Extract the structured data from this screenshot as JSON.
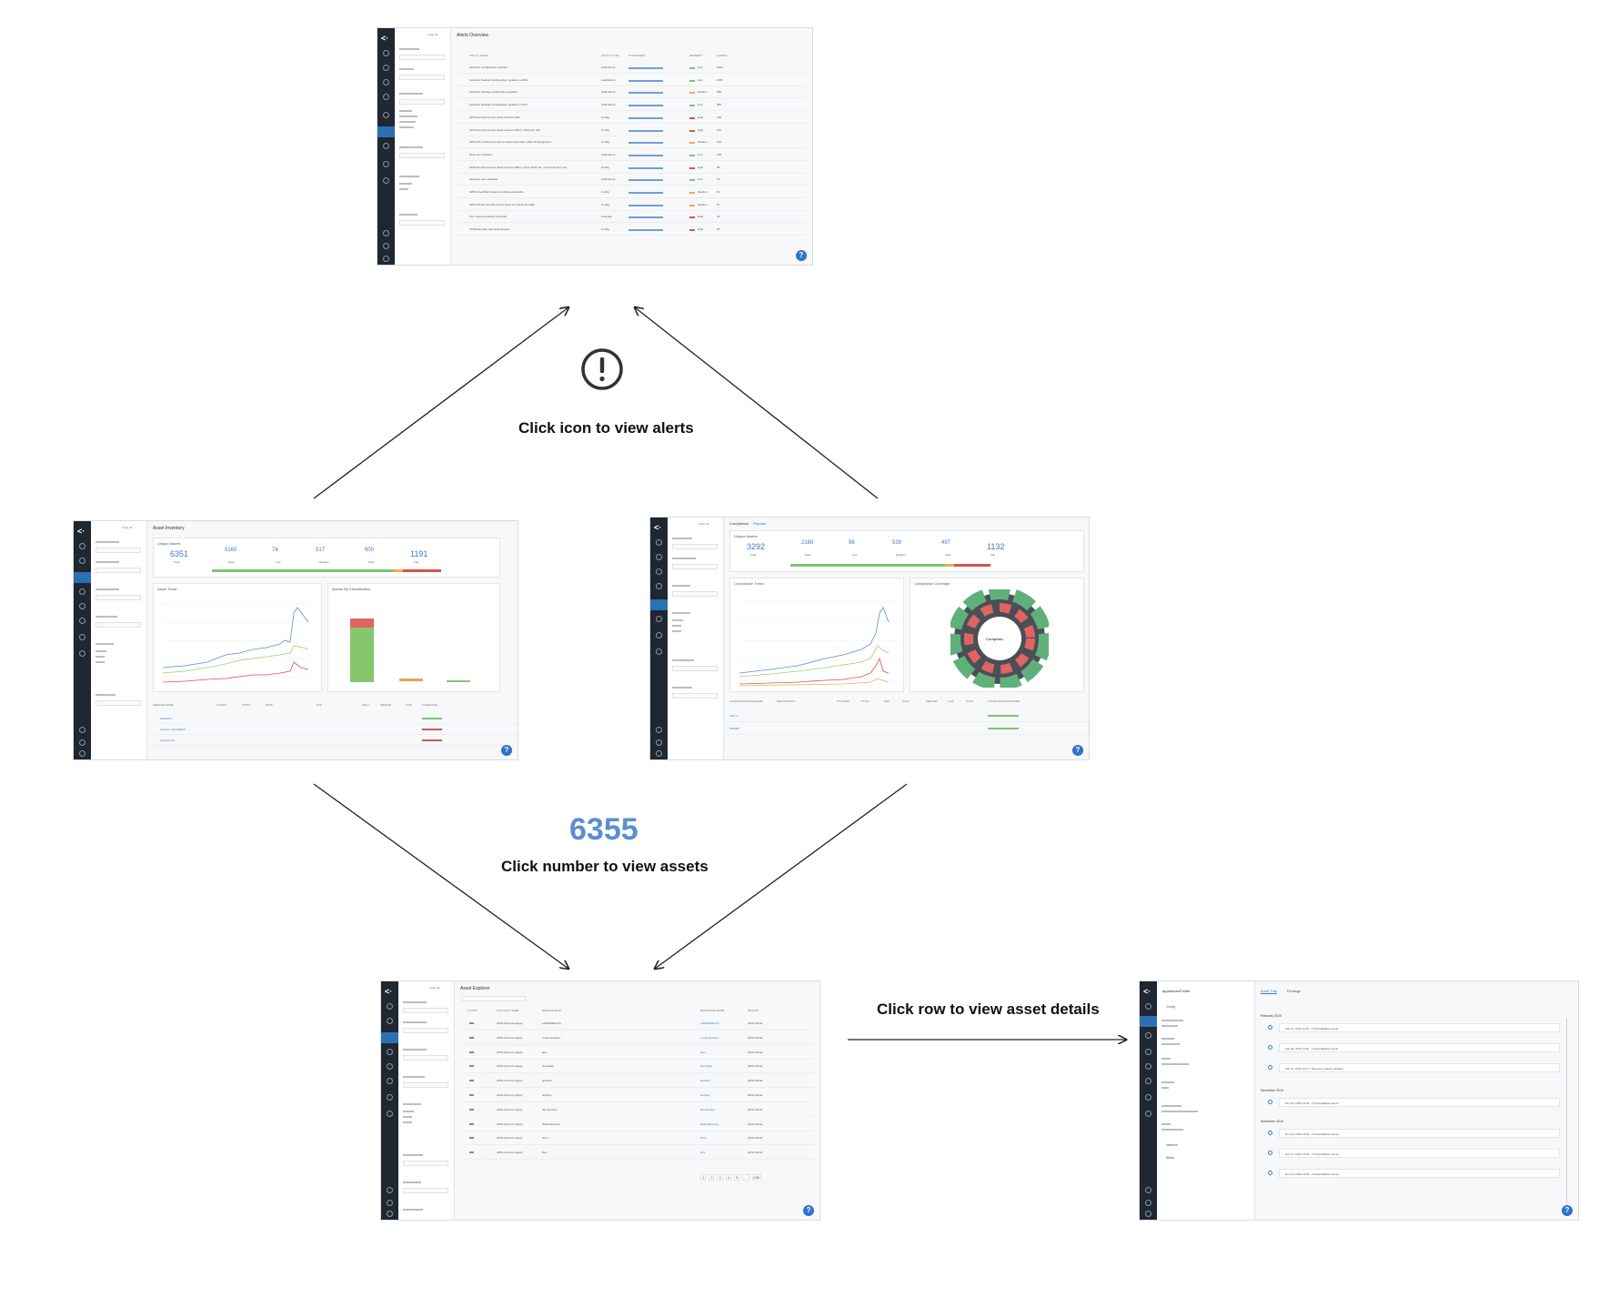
{
  "captions": {
    "alerts": "Click icon to view alerts",
    "assets": "Click number to view assets",
    "details": "Click row to view asset details"
  },
  "big_number": "6355",
  "icons": {
    "alert": "alert-circle-icon",
    "help": "help-icon"
  },
  "colors": {
    "accent": "#5b8ed2",
    "nav": "#1f2731",
    "pass": "#7cc474",
    "fail": "#d9534f",
    "medium": "#f0ad4e"
  },
  "alerts_screen": {
    "title": "Alerts Overview",
    "filter_label": "Clear All",
    "columns": [
      "POLICY NAME",
      "POLICY TYPE",
      "STANDARDS",
      "SEVERITY",
      "ALERTS"
    ],
    "rows": [
      {
        "policy": "Sensitive configuration updates",
        "type": "Audit Event",
        "sev": "Low",
        "alerts": "1642"
      },
      {
        "policy": "Sensitive Network configuration updates in AWS",
        "type": "Audit Event",
        "sev": "Low",
        "alerts": "1056"
      },
      {
        "policy": "Sensitive Storage configuration updates",
        "type": "Audit Event",
        "sev": "Medium",
        "alerts": "988"
      },
      {
        "policy": "Sensitive Network configuration updates in GCP",
        "type": "Audit Event",
        "sev": "Low",
        "alerts": "484"
      },
      {
        "policy": "AWS Security Groups allow internet traffic",
        "type": "Config",
        "sev": "High",
        "alerts": "319"
      },
      {
        "policy": "AWS Security Groups allow internet traffic to SSH port (22)",
        "type": "Config",
        "sev": "High",
        "alerts": "244"
      },
      {
        "policy": "AWS VPC subnets should not allow automatic public IP assignment",
        "type": "Config",
        "sev": "Medium",
        "alerts": "153"
      },
      {
        "policy": "Root user activities",
        "type": "Audit Event",
        "sev": "Low",
        "alerts": "108"
      },
      {
        "policy": "AWS Security Groups allow internet traffic to ports which are not commonly used",
        "type": "Config",
        "sev": "High",
        "alerts": "95"
      },
      {
        "policy": "Sensitive user activities",
        "type": "Audit Event",
        "sev": "Low",
        "alerts": "76"
      },
      {
        "policy": "AWS CloudTrail bucket is publicly accessible",
        "type": "Config",
        "sev": "Medium",
        "alerts": "66"
      },
      {
        "policy": "AWS Default Security Group does not restrict all traffic",
        "type": "Config",
        "sev": "Medium",
        "alerts": "57"
      },
      {
        "policy": "Port scanning activity (internal)",
        "type": "Anomaly",
        "sev": "High",
        "alerts": "29"
      },
      {
        "policy": "S3 Bucket (file) has Read access",
        "type": "Config",
        "sev": "High",
        "alerts": "25"
      }
    ]
  },
  "inventory_screen": {
    "title": "Asset Inventory",
    "filter_label": "Clear All",
    "card_title": "Unique Assets",
    "stats": [
      {
        "value": "6351",
        "label": "Total"
      },
      {
        "value": "5160",
        "label": "Pass"
      },
      {
        "value": "74",
        "label": "Low"
      },
      {
        "value": "517",
        "label": "Medium"
      },
      {
        "value": "600",
        "label": "High"
      },
      {
        "value": "1191",
        "label": "Fail"
      }
    ],
    "trend_title": "Asset Trend",
    "classification_title": "Assets By Classification",
    "legend": [
      "Fail",
      "Pass",
      "Resources"
    ],
    "bar_categories": [
      "AWS",
      "GCP",
      "Azure"
    ],
    "table_columns": [
      "SERVICE NAME",
      "CLOUD",
      "TOTAL",
      "PASS",
      "FAIL",
      "HIGH",
      "MEDIUM",
      "LOW",
      "COVERAGE"
    ],
    "table_rows": [
      "AWS EC2",
      "Amazon CloudWatch",
      "Amazon S3"
    ]
  },
  "compliance_screen": {
    "tabs": [
      "Compliance",
      "Reports"
    ],
    "filter_label": "Clear All",
    "card_title": "Unique Assets",
    "stats": [
      {
        "value": "3292",
        "label": "Total"
      },
      {
        "value": "2160",
        "label": "Pass"
      },
      {
        "value": "96",
        "label": "Low"
      },
      {
        "value": "539",
        "label": "Medium"
      },
      {
        "value": "497",
        "label": "High"
      },
      {
        "value": "1132",
        "label": "Fail"
      }
    ],
    "trend_title": "Compliance Trend",
    "coverage_title": "Compliance Coverage",
    "legend": [
      "Resources",
      "Fail",
      "Pass"
    ],
    "center_label": "Complian...",
    "table_columns": [
      "COMPLIANCE STANDARD",
      "DESCRIPTION",
      "POLICIES",
      "TOTAL",
      "FAIL",
      "HIGH",
      "MEDIUM",
      "LOW",
      "PASS",
      "COMPLIANCE POSTURE"
    ],
    "table_rows": [
      "SOC 2",
      "PIPEDA"
    ]
  },
  "explorer_screen": {
    "title": "Asset Explorer",
    "filter_label": "Clear All",
    "columns": [
      "CLOUD",
      "ACCOUNT NAME",
      "RESOURCE ID",
      "RESOURCE NAME",
      "REGION"
    ],
    "rows": [
      {
        "account": "AWS Account Legacy",
        "id": "e1b59590fcd7b",
        "region": "AWS Global"
      },
      {
        "account": "AWS Account Legacy",
        "id": "'meat-assassin'",
        "region": "AWS Global"
      },
      {
        "account": "AWS Account Legacy",
        "id": "ajun",
        "region": "AWS Global"
      },
      {
        "account": "AWS Account Legacy",
        "id": "demolsap",
        "region": "AWS Global"
      },
      {
        "account": "AWS Account Legacy",
        "id": "gerasch",
        "region": "AWS Global"
      },
      {
        "account": "AWS Account Legacy",
        "id": "techops",
        "region": "AWS Global"
      },
      {
        "account": "AWS Account Legacy",
        "id": "dev-techops",
        "region": "AWS Global"
      },
      {
        "account": "AWS Account Legacy",
        "id": "build-discovery",
        "region": "AWS Global"
      },
      {
        "account": "AWS Account Legacy",
        "id": "ibrnn",
        "region": "AWS Global"
      },
      {
        "account": "AWS Account Legacy",
        "id": "lbss",
        "region": "AWS Global"
      }
    ],
    "pagination": [
      "1",
      "2",
      "3",
      "4",
      "5",
      "...",
      "636"
    ]
  },
  "details_screen": {
    "resource_name": "appliancesProfile",
    "tabs": [
      "Audit Trail",
      "Findings"
    ],
    "sections": [
      "Config",
      "Network",
      "Alerts"
    ],
    "months": [
      "February 2020",
      "December 2019",
      "November 2019"
    ],
    "events": [
      "Feb 14, 2020 12:02 - 2 Vulnerabilities found",
      "Feb 09, 2020 13:00 - 2 Vulnerabilities found",
      "Feb 01, 2020 12:07 - Resource metrics updated",
      "Dec 22, 2019 13:03 - 2 Vulnerabilities found",
      "Nov 24, 2019 13:03 - 2 Vulnerabilities found",
      "Nov 17, 2019 13:03 - 2 Vulnerabilities found",
      "Nov 10, 2019 13:03 - 2 Vulnerabilities found"
    ]
  }
}
